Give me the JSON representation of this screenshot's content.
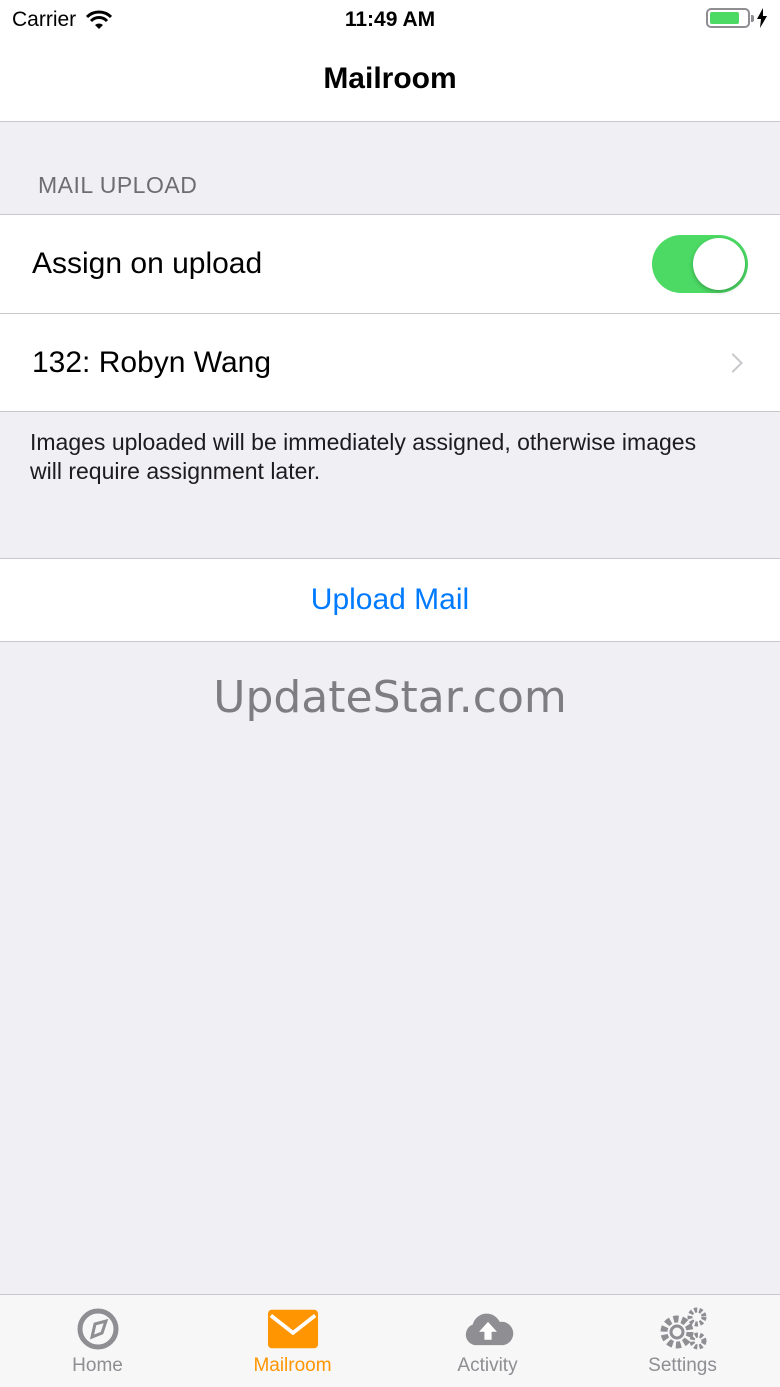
{
  "status_bar": {
    "carrier": "Carrier",
    "time": "11:49 AM",
    "battery_level": 0.8
  },
  "nav": {
    "title": "Mailroom"
  },
  "section": {
    "header": "MAIL UPLOAD",
    "assign_label": "Assign on upload",
    "assign_enabled": true,
    "assignee": "132: Robyn Wang",
    "footer": "Images uploaded will be immediately assigned, otherwise images will require assignment later."
  },
  "action": {
    "upload_label": "Upload Mail"
  },
  "watermark": "UpdateStar.com",
  "tabs": [
    {
      "label": "Home",
      "icon": "compass-icon",
      "active": false
    },
    {
      "label": "Mailroom",
      "icon": "envelope-icon",
      "active": true
    },
    {
      "label": "Activity",
      "icon": "cloud-upload-icon",
      "active": false
    },
    {
      "label": "Settings",
      "icon": "gears-icon",
      "active": false
    }
  ],
  "colors": {
    "accent": "#007aff",
    "active_tab": "#ff9500",
    "toggle_on": "#4cd964",
    "inactive_icon": "#8e8e93"
  }
}
